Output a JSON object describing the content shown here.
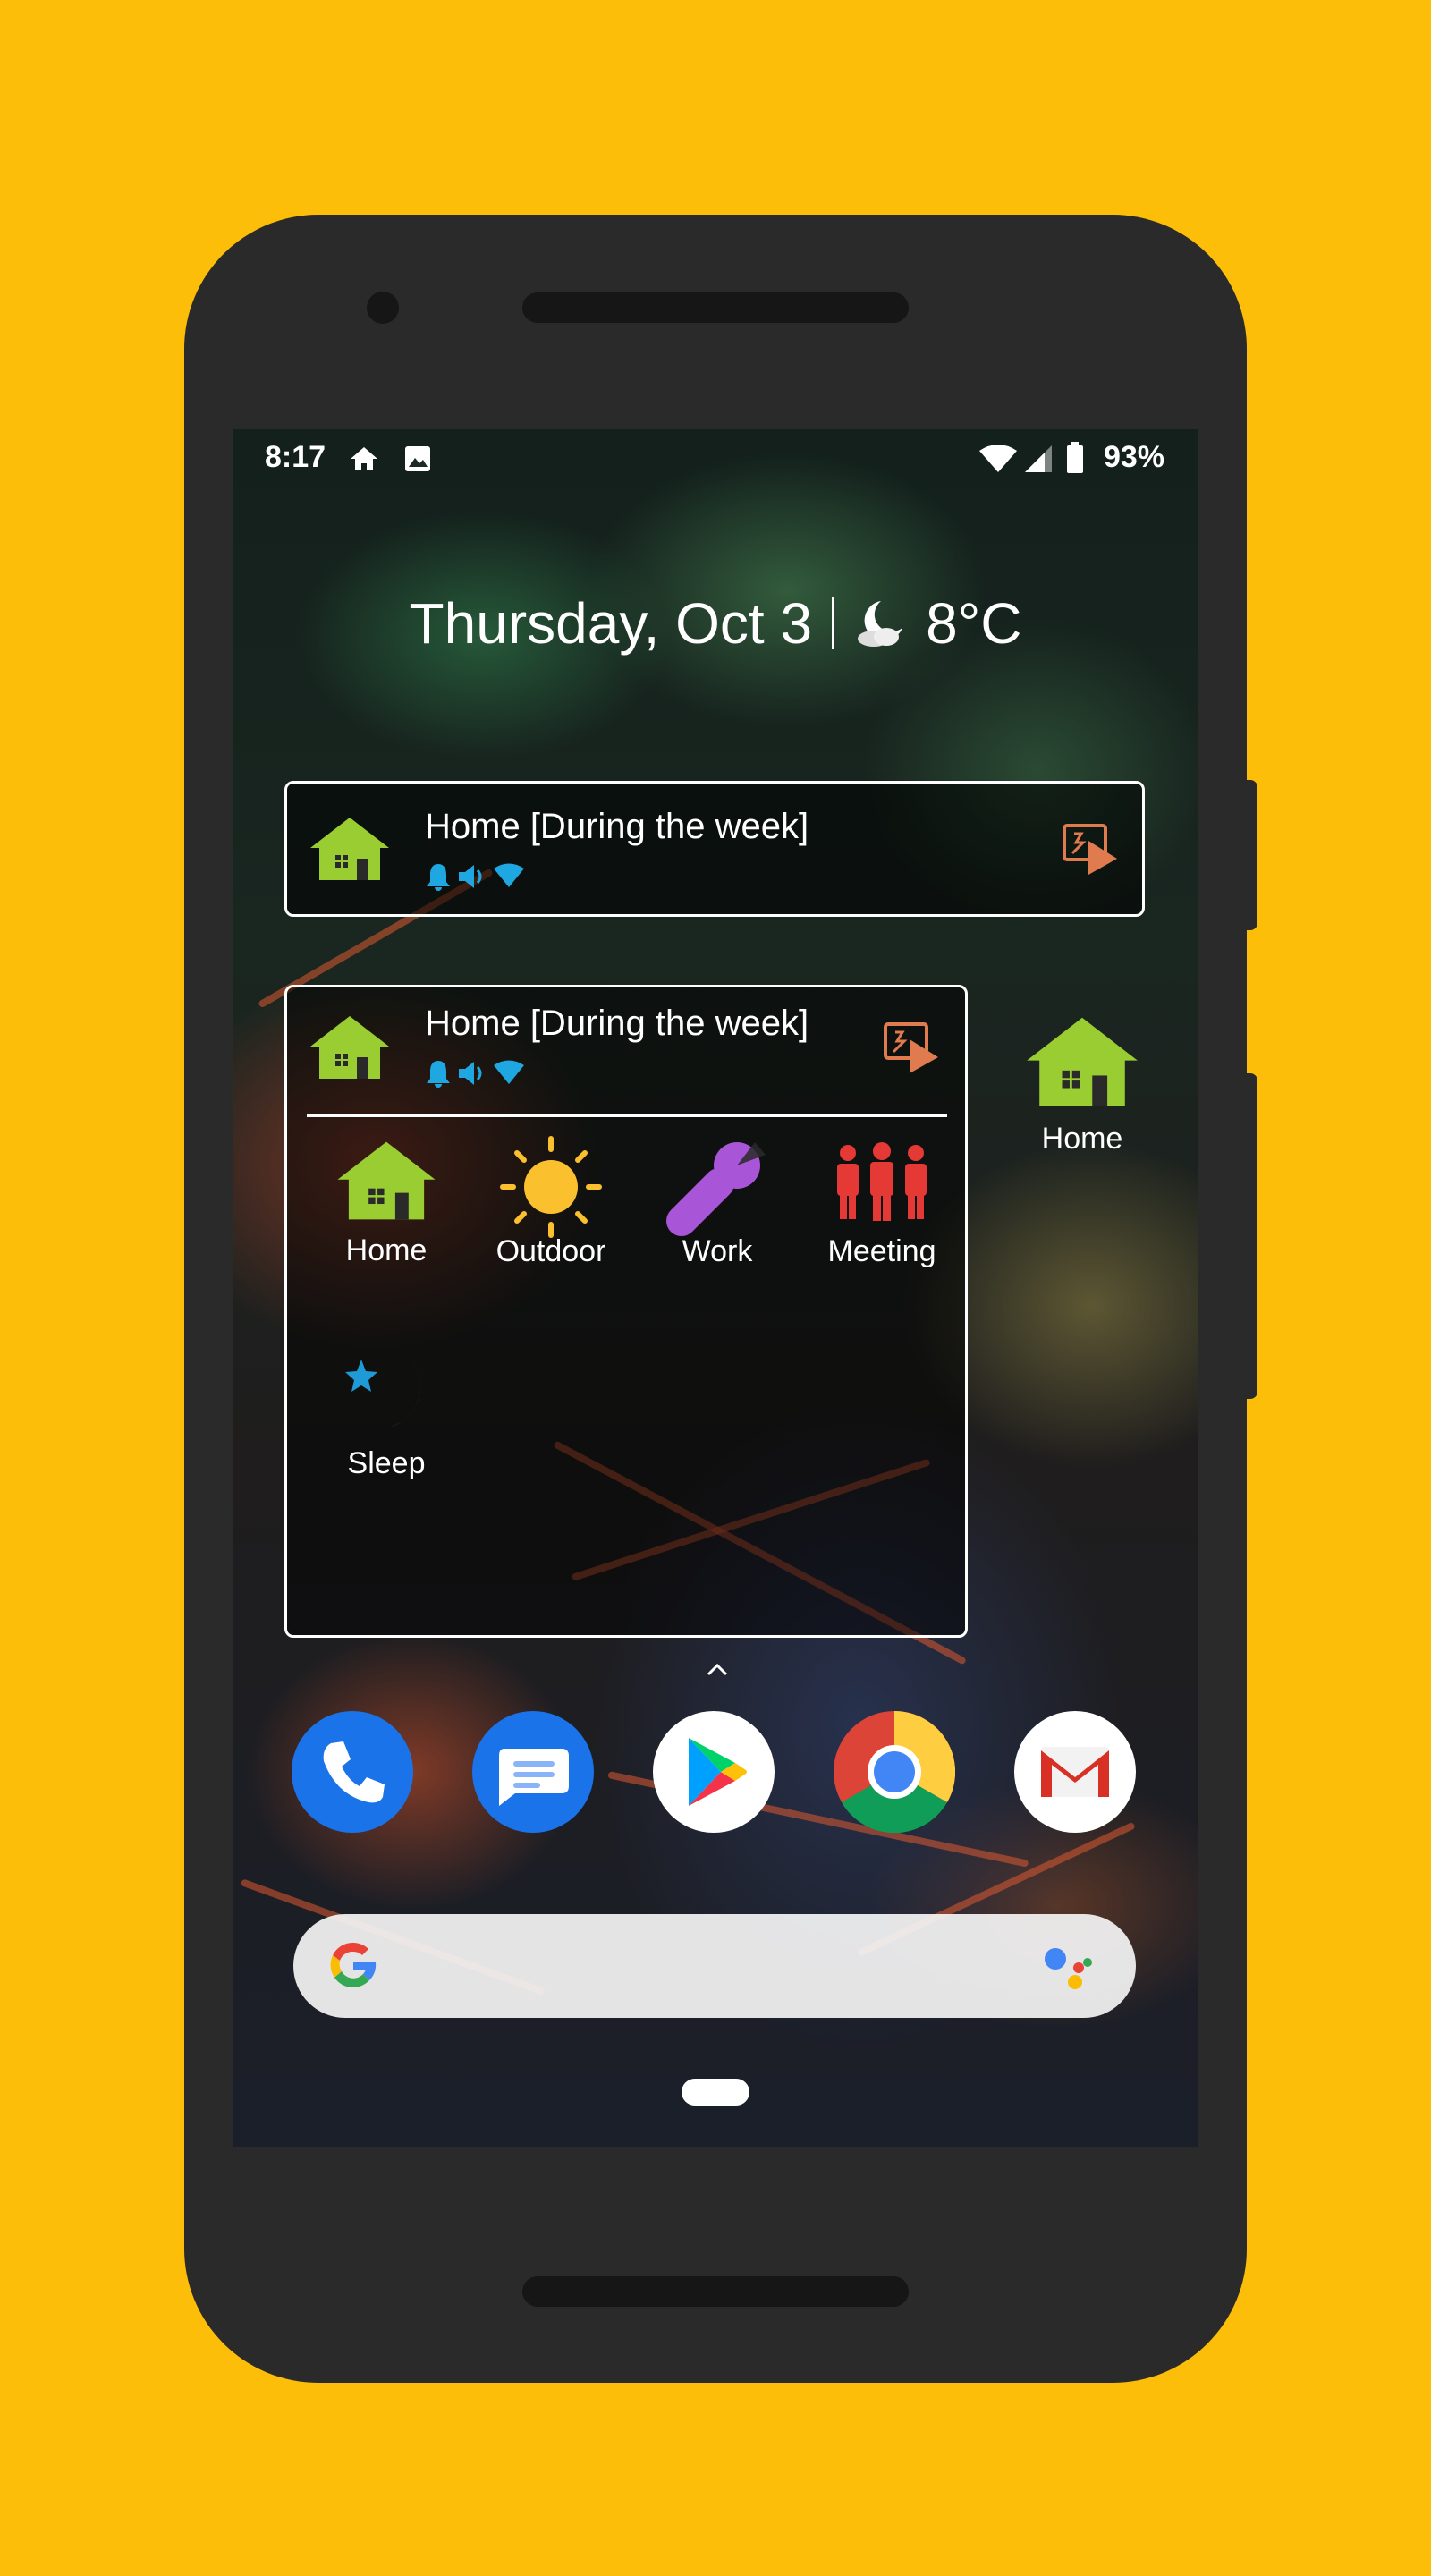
{
  "status_bar": {
    "time": "8:17",
    "battery": "93%",
    "icons": [
      "home-icon",
      "image-icon",
      "wifi-icon",
      "cell-signal-icon",
      "battery-icon"
    ]
  },
  "glance": {
    "date": "Thursday, Oct 3",
    "weather_icon": "moon-cloud-icon",
    "temperature": "8°C"
  },
  "widget_small": {
    "title": "Home [During the week]",
    "indicator_icons": [
      "bell-icon",
      "volume-icon",
      "wifi-icon"
    ],
    "action_icon": "run-shortcut-icon"
  },
  "widget_large": {
    "title": "Home [During the week]",
    "indicator_icons": [
      "bell-icon",
      "volume-icon",
      "wifi-icon"
    ],
    "action_icon": "run-shortcut-icon",
    "profiles": [
      {
        "label": "Home",
        "icon": "house-icon",
        "color": "#9ACD32"
      },
      {
        "label": "Outdoor",
        "icon": "sun-icon",
        "color": "#FBC02D"
      },
      {
        "label": "Work",
        "icon": "wrench-icon",
        "color": "#A855D8"
      },
      {
        "label": "Meeting",
        "icon": "people-icon",
        "color": "#E53935"
      },
      {
        "label": "Sleep",
        "icon": "moon-star-icon",
        "color": "#1E9BD7"
      }
    ]
  },
  "home_shortcut": {
    "label": "Home",
    "icon": "house-icon"
  },
  "dock": [
    {
      "app": "Phone",
      "icon": "phone-icon"
    },
    {
      "app": "Messages",
      "icon": "messages-icon"
    },
    {
      "app": "Play Store",
      "icon": "play-store-icon"
    },
    {
      "app": "Chrome",
      "icon": "chrome-icon"
    },
    {
      "app": "Gmail",
      "icon": "gmail-icon"
    }
  ],
  "search": {
    "left_icon": "google-g-icon",
    "right_icon": "assistant-icon"
  },
  "colors": {
    "background": "#FDBE0A",
    "phone_body": "#2A2A2A",
    "house_green": "#9ACD32",
    "indicator_blue": "#1EA7E0",
    "action_orange": "#E07A4F"
  }
}
